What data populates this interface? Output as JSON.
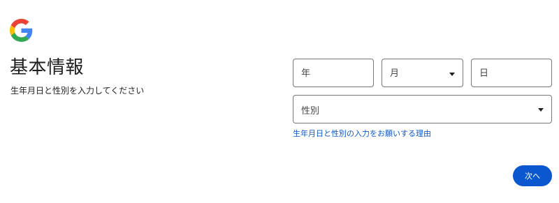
{
  "brand": {
    "logo_icon": "google-g-icon",
    "colors": {
      "blue": "#4285F4",
      "red": "#EA4335",
      "yellow": "#FBBC05",
      "green": "#34A853"
    }
  },
  "header": {
    "title": "基本情報",
    "subtitle": "生年月日と性別を入力してください"
  },
  "form": {
    "year": {
      "label": "年",
      "value": ""
    },
    "month": {
      "label": "月",
      "selected": "",
      "icon": "dropdown-caret-icon"
    },
    "day": {
      "label": "日",
      "value": ""
    },
    "gender": {
      "label": "性別",
      "selected": "",
      "icon": "dropdown-caret-icon"
    },
    "reason_link": "生年月日と性別の入力をお願いする理由"
  },
  "actions": {
    "next_label": "次へ"
  },
  "theme": {
    "accent": "#0b57d0",
    "border": "#747775",
    "text": "#1f1f1f"
  }
}
